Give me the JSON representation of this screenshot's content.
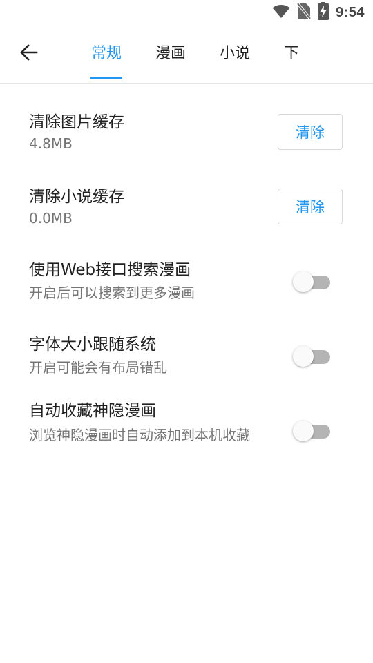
{
  "status_bar": {
    "time": "9:54",
    "icons": [
      "wifi-icon",
      "no-sim-icon",
      "battery-charging-icon"
    ]
  },
  "toolbar": {
    "back_icon": "arrow-left-icon",
    "tabs": [
      {
        "label": "常规",
        "active": true
      },
      {
        "label": "漫画",
        "active": false
      },
      {
        "label": "小说",
        "active": false
      },
      {
        "label": "下",
        "active": false
      }
    ]
  },
  "accent_color": "#2196f3",
  "settings": [
    {
      "title": "清除图片缓存",
      "value": "4.8MB",
      "action_label": "清除"
    },
    {
      "title": "清除小说缓存",
      "value": "0.0MB",
      "action_label": "清除"
    },
    {
      "title": "使用Web接口搜索漫画",
      "desc": "开启后可以搜索到更多漫画",
      "enabled": false
    },
    {
      "title": "字体大小跟随系统",
      "desc": "开启可能会有布局错乱",
      "enabled": false
    },
    {
      "title": "自动收藏神隐漫画",
      "desc": "浏览神隐漫画时自动添加到本机收藏",
      "enabled": false
    }
  ]
}
